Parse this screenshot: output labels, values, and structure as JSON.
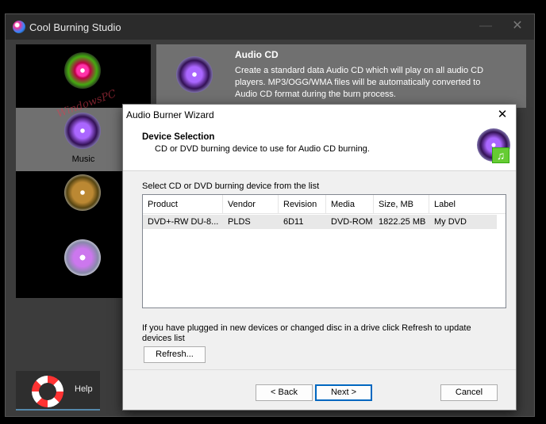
{
  "app": {
    "title": "Cool Burning Studio"
  },
  "sidebar": {
    "watermark": "WindowsPC",
    "items": [
      {
        "name": "burn",
        "label": ""
      },
      {
        "name": "music",
        "label": "Music"
      },
      {
        "name": "video",
        "label": ""
      },
      {
        "name": "copy",
        "label": ""
      }
    ]
  },
  "info": {
    "heading": "Audio CD",
    "description": "Create a standard data Audio CD which will play on all audio CD players. MP3/OGG/WMA files will be automatically converted to Audio CD format during the burn process."
  },
  "help": {
    "label": "Help"
  },
  "logo": {
    "text": "PC"
  },
  "dialog": {
    "title": "Audio Burner Wizard",
    "close": "✕",
    "header_title": "Device Selection",
    "header_subtitle": "CD or DVD burning device to use for Audio CD burning.",
    "list_caption": "Select CD or DVD burning device from the list",
    "columns": [
      "Product",
      "Vendor",
      "Revision",
      "Media",
      "Size, MB",
      "Label"
    ],
    "rows": [
      {
        "product": "DVD+-RW DU-8...",
        "vendor": "PLDS",
        "revision": "6D11",
        "media": "DVD-ROM",
        "size": "1822.25 MB",
        "label": "My DVD"
      }
    ],
    "refresh_note": "If you have plugged in new devices or changed disc in a drive click Refresh to update devices list",
    "refresh_button": "Refresh...",
    "back_button": "< Back",
    "next_button": "Next >",
    "cancel_button": "Cancel",
    "note_icon": "♫"
  },
  "icons": {
    "app": "app-disc-icon",
    "close": "close-icon",
    "minimize": "minimize-icon"
  }
}
